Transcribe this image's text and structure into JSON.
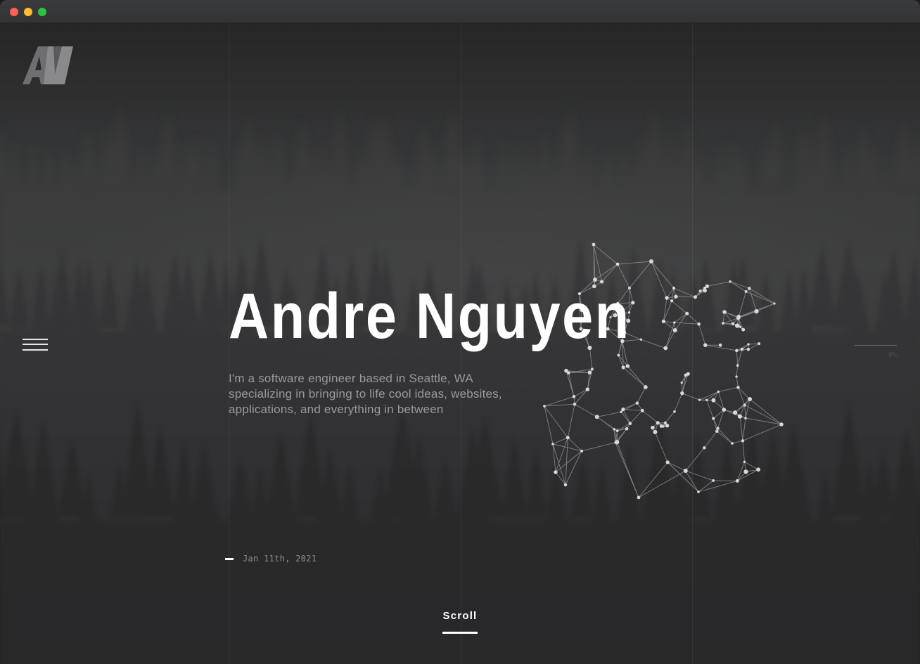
{
  "window": {
    "controls": [
      "close",
      "minimize",
      "maximize"
    ]
  },
  "header": {
    "logo_icon": "av-monogram-logo",
    "logo_text": "AV"
  },
  "nav": {
    "menu_icon": "hamburger-menu-icon"
  },
  "hero": {
    "name": "Andre Nguyen",
    "description": "I'm a software engineer based in Seattle, WA specializing in bringing to life cool ideas, websites, applications, and everything in between",
    "graphic": "node-network-graphic"
  },
  "scroll_progress": {
    "value": "0%"
  },
  "footer": {
    "date": "Jan 11th, 2021",
    "scroll_label": "Scroll"
  },
  "colors": {
    "background": "#1a1a1b",
    "accent": "#ffffff",
    "muted_text": "#9a9a9c"
  }
}
